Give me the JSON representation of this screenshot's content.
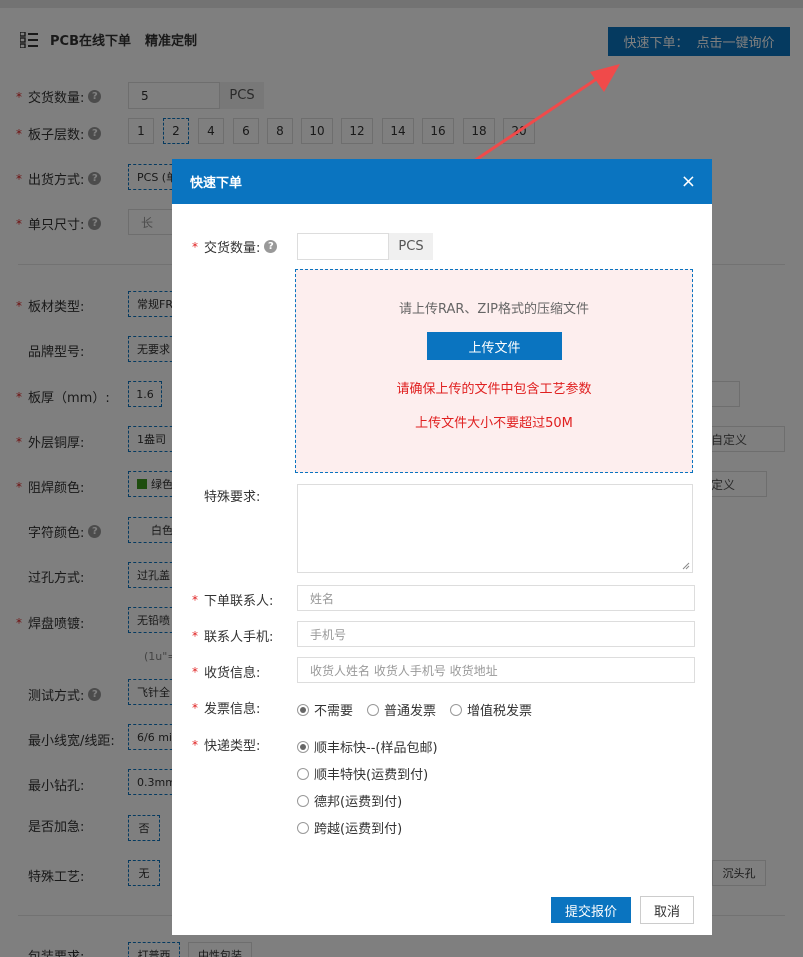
{
  "header": {
    "title": "PCB在线下单",
    "subtitle": "精准定制",
    "quick_btn_left": "快速下单：",
    "quick_btn_right": "点击一键询价"
  },
  "form": {
    "qty_label": "交货数量:",
    "qty_value": "5",
    "qty_unit": "PCS",
    "layers_label": "板子层数:",
    "layers": [
      "1",
      "2",
      "4",
      "6",
      "8",
      "10",
      "12",
      "14",
      "16",
      "18",
      "20"
    ],
    "layers_selected": "2",
    "ship_label": "出货方式:",
    "ship_value": "PCS (单",
    "size_label": "单只尺寸:",
    "size_ph": "长",
    "material_label": "板材类型:",
    "material_value": "常规FR",
    "brand_label": "品牌型号:",
    "brand_value": "无要求",
    "thick_label": "板厚（mm）:",
    "thick_value": "1.6",
    "copper_label": "外层铜厚:",
    "copper_value": "1盎司",
    "copper_custom": "自定义",
    "mask_label": "阻焊颜色:",
    "mask_value": "绿色",
    "mask_custom": "定义",
    "char_label": "字符颜色:",
    "char_value": "白色",
    "via_label": "过孔方式:",
    "via_value": "过孔盖",
    "pad_label": "焊盘喷镀:",
    "pad_value": "无铅喷",
    "pad_note": "(1u\"=0",
    "test_label": "测试方式:",
    "test_value": "飞针全",
    "line_label": "最小线宽/线距:",
    "line_value": "6/6 mil",
    "drill_label": "最小钻孔:",
    "drill_value": "0.3mm",
    "urgent_label": "是否加急:",
    "urgent_value": "否",
    "special_label": "特殊工艺:",
    "special_value": "无",
    "special_extra": "沉头孔",
    "pack_label": "包装要求:",
    "pack_value1": "打普西",
    "pack_value2": "中性包装"
  },
  "modal": {
    "title": "快速下单",
    "close": "×",
    "qty_label": "交货数量:",
    "qty_unit": "PCS",
    "upload_hint": "请上传RAR、ZIP格式的压缩文件",
    "upload_btn": "上传文件",
    "warn1": "请确保上传的文件中包含工艺参数",
    "warn2": "上传文件大小不要超过50M",
    "special_label": "特殊要求:",
    "contact_label": "下单联系人:",
    "contact_ph": "姓名",
    "phone_label": "联系人手机:",
    "phone_ph": "手机号",
    "addr_label": "收货信息:",
    "addr_ph": "收货人姓名 收货人手机号 收货地址",
    "invoice_label": "发票信息:",
    "invoice_opts": [
      "不需要",
      "普通发票",
      "增值税发票"
    ],
    "express_label": "快递类型:",
    "express_opts": [
      "顺丰标快--(样品包邮)",
      "顺丰特快(运费到付)",
      "德邦(运费到付)",
      "跨越(运费到付)"
    ],
    "submit": "提交报价",
    "cancel": "取消"
  },
  "colors": {
    "primary": "#0a74c0",
    "required": "#e02020",
    "arrow": "#f04a4a"
  }
}
